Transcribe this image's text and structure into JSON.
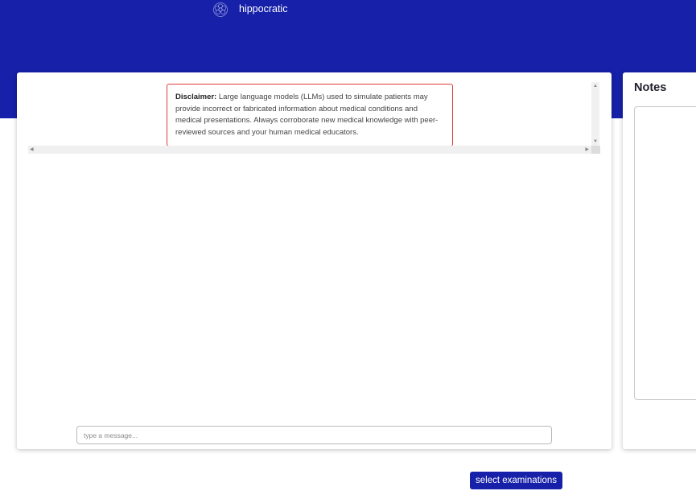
{
  "header": {
    "brand_name": "hippocratic",
    "logo_icon": "hippocratic-logo-icon",
    "background_color": "#1620a8"
  },
  "chat": {
    "disclaimer": {
      "label": "Disclaimer:",
      "text": "Large language models (LLMs) used to simulate patients may provide incorrect or fabricated information about medical conditions and medical presentations. Always corroborate new medical knowledge with peer-reviewed sources and your human medical educators.",
      "border_color": "#e23a3a"
    },
    "input": {
      "placeholder": "type a message...",
      "value": ""
    }
  },
  "notes": {
    "title": "Notes",
    "value": ""
  },
  "actions": {
    "select_examinations_label": "select examinations",
    "button_color": "#1620a8"
  }
}
